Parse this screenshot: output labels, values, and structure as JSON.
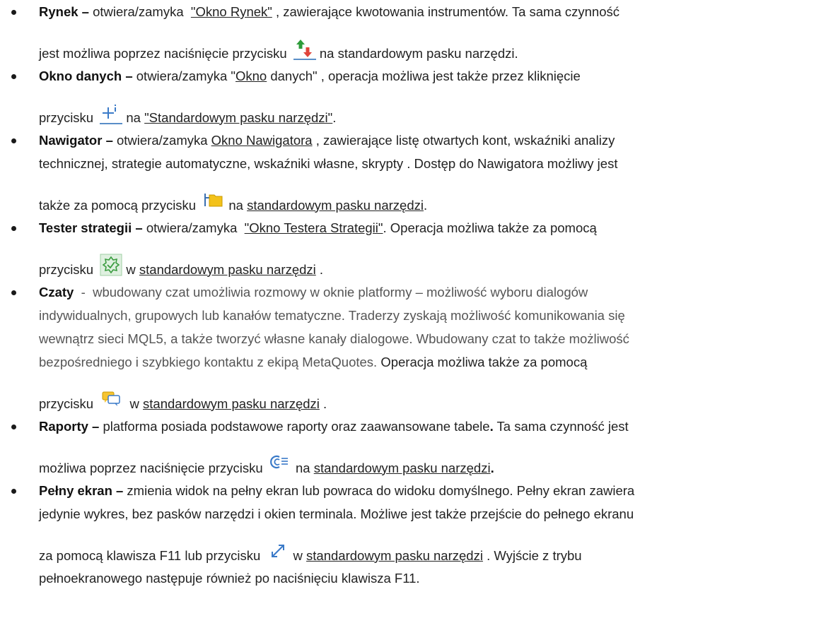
{
  "items": [
    {
      "term": "Rynek –",
      "l1_a": " otwiera/zamyka  ",
      "l1_link": "\"Okno Rynek\"",
      "l1_b": " , zawierające kwotowania instrumentów. Ta sama czynność",
      "l2_a": "jest możliwa poprzez naciśnięcie przycisku ",
      "icon": "market-watch-icon",
      "l2_b": " na standardowym pasku narzędzi."
    },
    {
      "term": "Okno danych –",
      "l1_a": " otwiera/zamyka \"",
      "l1_link": "Okno",
      "l1_b": " danych\" , operacja możliwa jest także przez kliknięcie",
      "l2_a": "przycisku ",
      "icon": "data-window-icon",
      "l2_b": " na ",
      "l2_link": "\"Standardowym pasku narzędzi\"",
      "l2_c": "."
    },
    {
      "term": "Nawigator –",
      "l1_a": " otwiera/zamyka ",
      "l1_link": "Okno Nawigatora",
      "l1_b": " , zawierające listę otwartych kont, wskaźniki analizy",
      "l2": "technicznej, strategie automatyczne, wskaźniki własne, skrypty . Dostęp do Nawigatora możliwy jest",
      "l3_a": "także za pomocą przycisku ",
      "icon": "navigator-icon",
      "l3_b": " na ",
      "l3_link": "standardowym pasku narzędzi",
      "l3_c": "."
    },
    {
      "term": "Tester strategii –",
      "l1_a": " otwiera/zamyka  ",
      "l1_link": "\"Okno Testera Strategii\"",
      "l1_b": ". Operacja możliwa także za pomocą",
      "l2_a": "przycisku ",
      "icon": "strategy-tester-icon",
      "l2_b": " w ",
      "l2_link": "standardowym pasku narzędzi",
      "l2_c": " ."
    },
    {
      "term": "Czaty",
      "l1": "  -  wbudowany czat umożliwia rozmowy w oknie platformy – możliwość wyboru dialogów",
      "l2": "indywidualnych, grupowych lub kanałów tematyczne. Traderzy zyskają możliwość komunikowania się",
      "l3": "wewnątrz sieci MQL5, a także tworzyć własne kanały dialogowe. Wbudowany czat to także możliwość",
      "l4_grey": "bezpośredniego i szybkiego kontaktu z ekipą MetaQuotes.",
      "l4_b": " Operacja możliwa także za pomocą",
      "l5_a": "przycisku ",
      "icon": "chats-icon",
      "l5_b": "  w ",
      "l5_link": "standardowym pasku narzędzi",
      "l5_c": " ."
    },
    {
      "term": "Raporty –",
      "l1_a": " platforma posiada podstawowe raporty oraz zaawansowane tabele",
      "l1_bold": ".",
      "l1_b": " Ta sama czynność jest",
      "l2_a": "możliwa poprzez naciśnięcie przycisku ",
      "icon": "reports-icon",
      "l2_b": " na ",
      "l2_link": "standardowym pasku narzędzi",
      "l2_bold": "."
    },
    {
      "term": "Pełny ekran –",
      "l1": " zmienia widok na pełny ekran lub powraca do widoku domyślnego. Pełny ekran zawiera",
      "l2": "jedynie wykres, bez pasków narzędzi i okien terminala. Możliwe jest także przejście do pełnego ekranu",
      "l3_a": "za pomocą klawisza F11 lub przycisku ",
      "icon": "fullscreen-icon",
      "l3_b": " w ",
      "l3_link": "standardowym pasku narzędzi",
      "l3_c": " . Wyjście z trybu",
      "l4": "pełnoekranowego następuje również po naciśnięciu klawisza F11."
    }
  ]
}
